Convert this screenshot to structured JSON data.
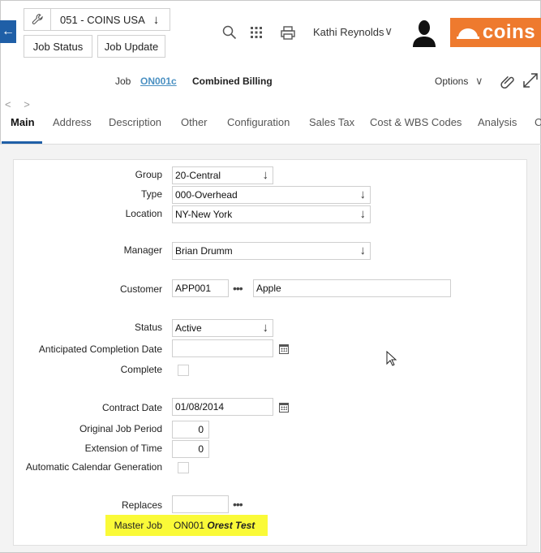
{
  "header": {
    "company": "051 - COINS USA",
    "job_status_label": "Job Status",
    "job_update_label": "Job Update",
    "user_name": "Kathi Reynolds",
    "logo_text": "coins",
    "brand_color": "#ee7a2e",
    "accent_color": "#1f5fa7"
  },
  "job": {
    "label": "Job",
    "code": "ON001c",
    "name": "Combined Billing",
    "options_label": "Options"
  },
  "tabs": [
    {
      "label": "Main"
    },
    {
      "label": "Address"
    },
    {
      "label": "Description"
    },
    {
      "label": "Other"
    },
    {
      "label": "Configuration"
    },
    {
      "label": "Sales Tax"
    },
    {
      "label": "Cost & WBS Codes"
    },
    {
      "label": "Analysis"
    },
    {
      "label": "C"
    }
  ],
  "tab_nav": "< >",
  "form": {
    "group": {
      "label": "Group",
      "value": "20-Central"
    },
    "type": {
      "label": "Type",
      "value": "000-Overhead"
    },
    "location": {
      "label": "Location",
      "value": "NY-New York"
    },
    "manager": {
      "label": "Manager",
      "value": "Brian Drumm"
    },
    "customer": {
      "label": "Customer",
      "code": "APP001",
      "name": "Apple"
    },
    "status": {
      "label": "Status",
      "value": "Active"
    },
    "anticipated_completion": {
      "label": "Anticipated Completion Date",
      "value": ""
    },
    "complete": {
      "label": "Complete",
      "checked": false
    },
    "contract_date": {
      "label": "Contract Date",
      "value": "01/08/2014"
    },
    "original_job_period": {
      "label": "Original Job Period",
      "value": "0"
    },
    "extension_of_time": {
      "label": "Extension of Time",
      "value": "0"
    },
    "auto_calendar": {
      "label": "Automatic Calendar Generation",
      "checked": false
    },
    "replaces": {
      "label": "Replaces",
      "value": ""
    },
    "master_job": {
      "label": "Master Job",
      "code": "ON001",
      "name": "Orest Test"
    }
  },
  "icons": {
    "dots_glyph": "•••",
    "chevron_down": "∨",
    "arrow_down": "↓"
  }
}
